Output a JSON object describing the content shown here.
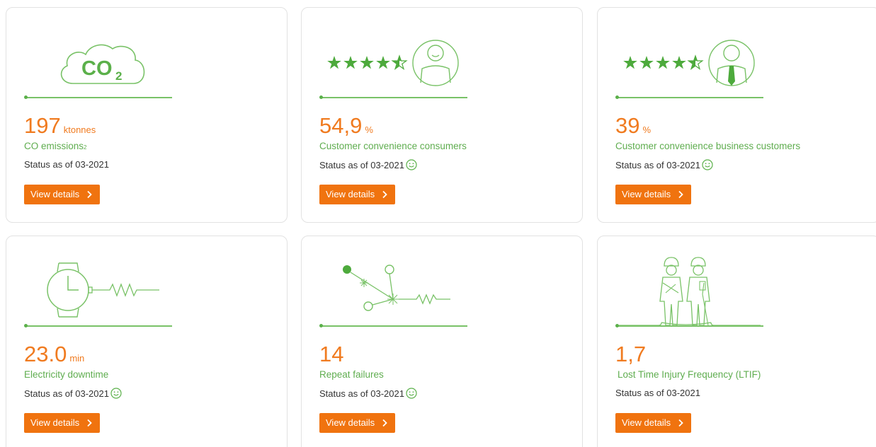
{
  "common": {
    "button_label": "View details"
  },
  "cards": [
    {
      "value": "197",
      "unit": "ktonnes",
      "label": "CO emissions",
      "label_sub": "2",
      "status": "Status as of 03-2021",
      "smiley": false,
      "icon": "co2-cloud-icon"
    },
    {
      "value": "54,9",
      "unit": "%",
      "label": "Customer convenience consumers",
      "status": "Status as of 03-2021",
      "smiley": true,
      "rating": 4.5,
      "icon": "consumer-avatar-icon"
    },
    {
      "value": "39",
      "unit": "%",
      "label": "Customer convenience business customers",
      "status": "Status as of 03-2021",
      "smiley": true,
      "rating": 4.5,
      "icon": "business-avatar-icon"
    },
    {
      "value": "23.0",
      "unit": "min",
      "label": "Electricity downtime",
      "status": "Status as of 03-2021",
      "smiley": true,
      "icon": "stopwatch-icon"
    },
    {
      "value": "14",
      "unit": "",
      "label": "Repeat failures",
      "status": "Status as of 03-2021",
      "smiley": true,
      "icon": "network-failure-icon"
    },
    {
      "value": "1,7",
      "unit": "",
      "label": "Lost Time Injury Frequency (LTIF)",
      "status": "Status as of 03-2021",
      "smiley": false,
      "icon": "workers-icon"
    }
  ],
  "colors": {
    "accent_orange": "#f07b20",
    "button_orange": "#f0730f",
    "green": "#5fad4f",
    "line_green": "#79c267"
  }
}
